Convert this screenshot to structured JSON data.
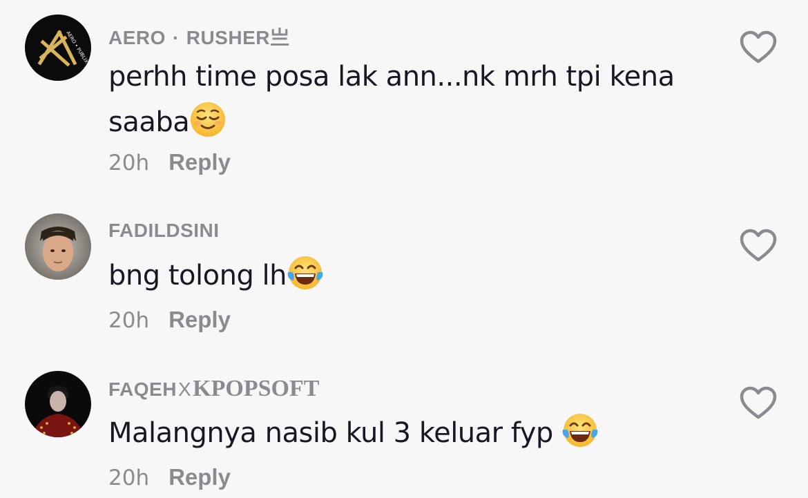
{
  "comments": [
    {
      "username_part1": "AERO",
      "separator": "·",
      "username_part2": "RUSHER亗",
      "text": "perhh time posa lak ann...nk mrh tpi kena saaba",
      "emoji": "relieved-face",
      "time": "20h",
      "reply_label": "Reply",
      "avatar_logo_text": "AERO • PUBLIX"
    },
    {
      "username": "FADILDSINI",
      "text": "bng tolong lh",
      "emoji": "face-with-tears-of-joy",
      "time": "20h",
      "reply_label": "Reply"
    },
    {
      "username_part1": "FAQEH",
      "username_x": "X",
      "username_part2": "KPOPSOFT",
      "text": "Malangnya nasib kul 3 keluar fyp",
      "emoji": "face-with-tears-of-joy",
      "time": "20h",
      "reply_label": "Reply"
    }
  ],
  "colors": {
    "background": "#f7f7f8",
    "username": "#8a8b91",
    "text": "#161823",
    "meta": "#8a8b91",
    "heart_outline": "#8a8b91"
  },
  "icons": {
    "like": "heart-outline-icon"
  }
}
